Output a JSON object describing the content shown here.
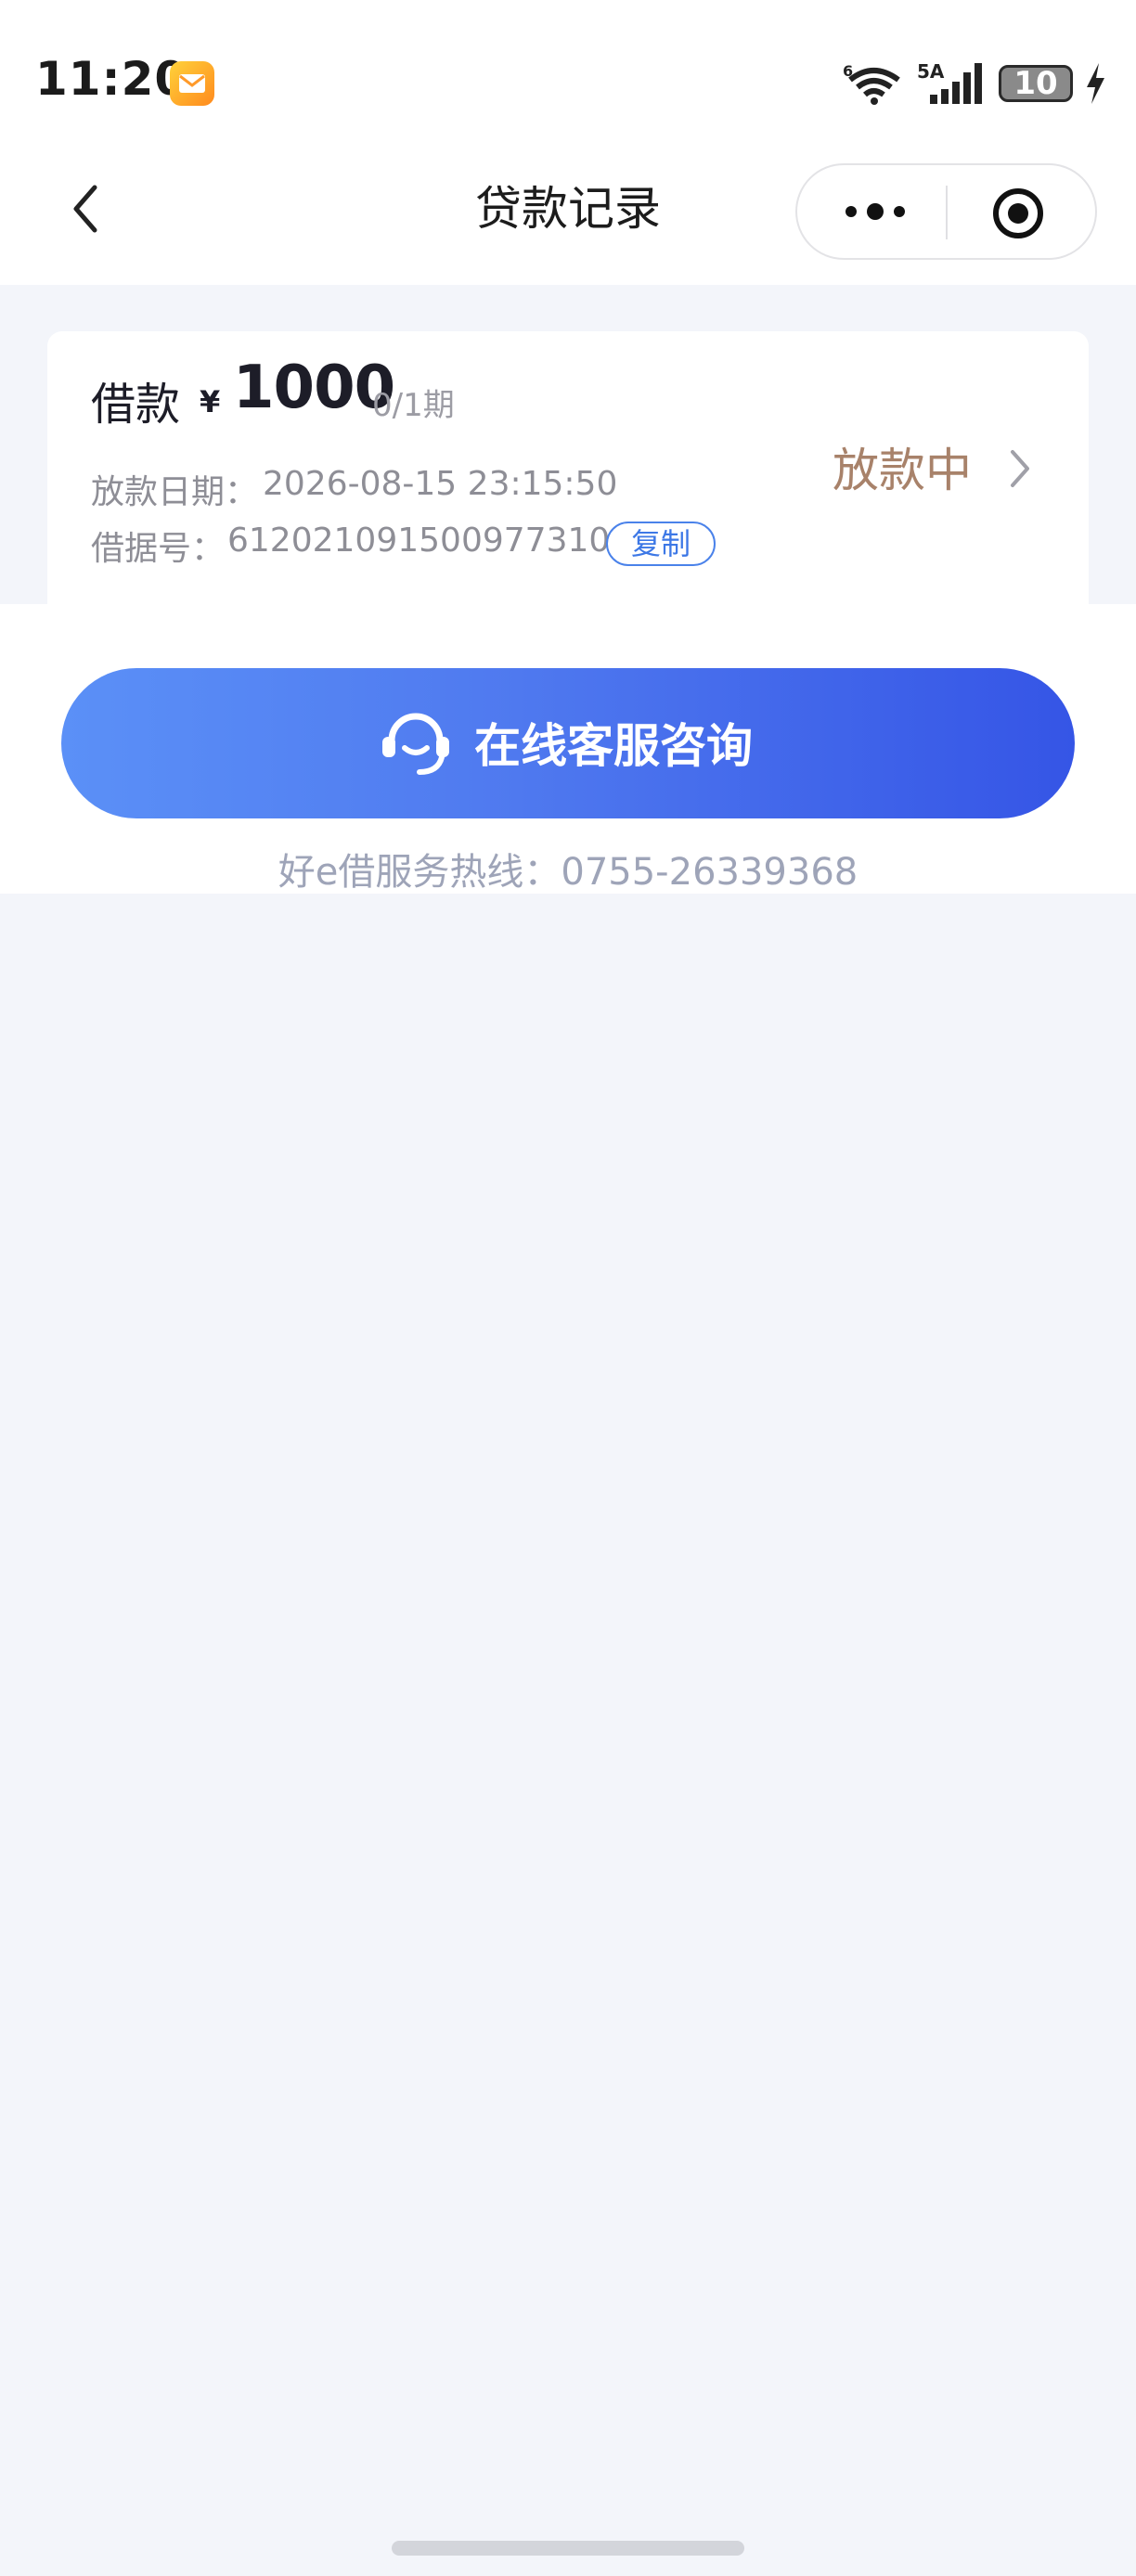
{
  "status_bar": {
    "time": "11:20",
    "battery": "10",
    "icons": [
      "mail-icon",
      "wifi-icon",
      "signal-icon",
      "battery-icon",
      "charging-bolt-icon"
    ]
  },
  "nav": {
    "title": "贷款记录",
    "icons": [
      "back-arrow-icon",
      "more-dots-icon",
      "close-target-icon"
    ]
  },
  "loan": {
    "label": "借款",
    "currency": "¥",
    "amount": "1000",
    "period": "0/1期",
    "date_label": "放款日期：",
    "date": "2026-08-15 23:15:50",
    "receipt_label": "借据号：",
    "receipt_no": "612021091500977310",
    "copy_label": "复制",
    "status": "放款中",
    "status_color": "#a8826a"
  },
  "service": {
    "button_label": "在线客服咨询",
    "hotline": "好e借服务热线：0755-26339368",
    "accent_from": "#5b90f7",
    "accent_to": "#3555e6"
  }
}
